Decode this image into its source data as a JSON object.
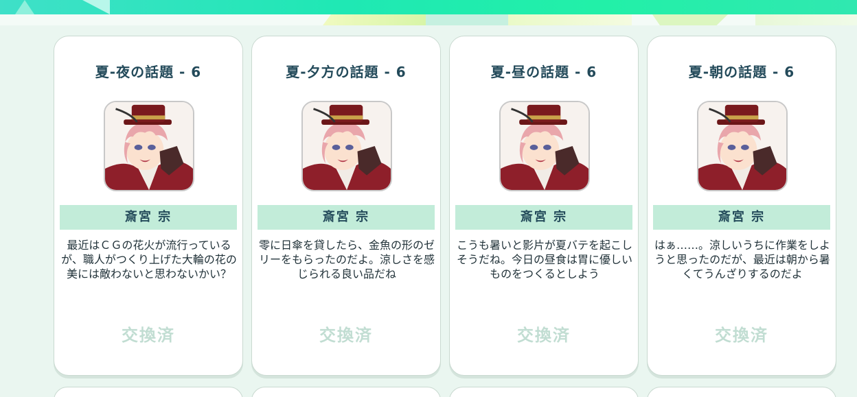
{
  "cards": [
    {
      "title": "夏-夜の話題 - 6",
      "name": "斎宮 宗",
      "quote": "最近はＣＧの花火が流行っているが、職人がつくり上げた大輪の花の美には敵わないと思わないかい？",
      "status": "交換済"
    },
    {
      "title": "夏-夕方の話題 - 6",
      "name": "斎宮 宗",
      "quote": "零に日傘を貸したら、金魚の形のゼリーをもらったのだよ。涼しさを感じられる良い品だね",
      "status": "交換済"
    },
    {
      "title": "夏-昼の話題 - 6",
      "name": "斎宮 宗",
      "quote": "こうも暑いと影片が夏バテを起こしそうだね。今日の昼食は胃に優しいものをつくるとしよう",
      "status": "交換済"
    },
    {
      "title": "夏-朝の話題 - 6",
      "name": "斎宮 宗",
      "quote": "はぁ……。涼しいうちに作業をしようと思ったのだが、最近は朝から暑くてうんざりするのだよ",
      "status": "交換済"
    }
  ],
  "portrait_icon": "character-portrait-icon",
  "colors": {
    "banner_accent": "#1fe8b4",
    "name_bar": "#c2ecd9",
    "title_text": "#234a5a",
    "status_text": "#c1ddd2",
    "background": "#eaf6f0"
  }
}
